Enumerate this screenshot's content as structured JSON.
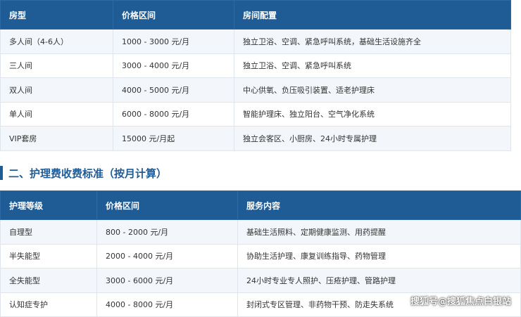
{
  "room_table": {
    "headers": [
      "房型",
      "价格区间",
      "房间配置"
    ],
    "rows": [
      [
        "多人间（4-6人）",
        "1000 - 3000 元/月",
        "独立卫浴、空调、紧急呼叫系统，基础生活设施齐全"
      ],
      [
        "三人间",
        "3000 - 4000 元/月",
        "独立卫浴、空调、紧急呼叫系统"
      ],
      [
        "双人间",
        "4000 - 5000 元/月",
        "中心供氧、负压吸引装置、适老护理床"
      ],
      [
        "单人间",
        "6000 - 8000 元/月",
        "智能护理床、独立阳台、空气净化系统"
      ],
      [
        "VIP套房",
        "15000 元/月起",
        "独立会客区、小厨房、24小时专属护理"
      ]
    ]
  },
  "section2": {
    "title": "二、护理费收费标准（按月计算）"
  },
  "care_table": {
    "headers": [
      "护理等级",
      "价格区间",
      "服务内容"
    ],
    "rows": [
      [
        "自理型",
        "800 - 2000 元/月",
        "基础生活照料、定期健康监测、用药提醒"
      ],
      [
        "半失能型",
        "2000 - 4000 元/月",
        "协助生活护理、康复训练指导、药物管理"
      ],
      [
        "全失能型",
        "3000 - 6000 元/月",
        "24小时专业专人照护、压疮护理、管路护理"
      ],
      [
        "认知症专护",
        "4000 - 8000 元/月",
        "封闭式专区管理、非药物干预、防走失系统"
      ]
    ]
  },
  "watermark": "搜狐号@搜狐焦点白银站",
  "colors": {
    "header_bg": "#1f5c96",
    "accent": "#1f5c96",
    "alt_row": "#f3f6fa"
  }
}
